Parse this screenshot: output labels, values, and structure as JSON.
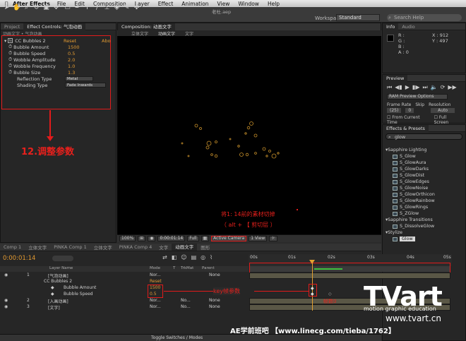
{
  "menubar": {
    "apple": "",
    "app_name": "After Effects",
    "items": [
      "File",
      "Edit",
      "Composition",
      "Layer",
      "Effect",
      "Animation",
      "View",
      "Window",
      "Help"
    ]
  },
  "document_title": "老杜.aep",
  "workspace": {
    "label": "Workspace:",
    "value": "Standard"
  },
  "search_help": "Search Help",
  "project_tabs": {
    "project": "Project",
    "effect_controls": "Effect Controls: 气泡动画"
  },
  "effect_controls": {
    "breadcrumb": "动画文字 • 气泡动画",
    "effect_name": "CC Bubbles 2",
    "reset": "Reset",
    "about": "Abo",
    "params": [
      {
        "name": "Bubble Amount",
        "value": "1500"
      },
      {
        "name": "Bubble Speed",
        "value": "0.5"
      },
      {
        "name": "Wobble Amplitude",
        "value": "2.0"
      },
      {
        "name": "Wobble Frequency",
        "value": "1.0"
      },
      {
        "name": "Bubble Size",
        "value": "1.3"
      }
    ],
    "reflection_type": {
      "name": "Reflection Type",
      "value": "Metal"
    },
    "shading_type": {
      "name": "Shading Type",
      "value": "Fade Inwards"
    }
  },
  "annotation_adjust": "12.调整参数",
  "composition": {
    "tab": "Composition: 动画文字",
    "subtabs": [
      "立体文字",
      "动画文字",
      "文字"
    ]
  },
  "viewer_controls": {
    "zoom": "100%",
    "timecode": "0:00:01:14",
    "resolution": "Full",
    "camera": "Active Camera",
    "views": "1 View"
  },
  "annotation_cut": "将1:  14前的素材切掉",
  "annotation_cut_sub": "（ alt + 【 剪切层 ）",
  "info": {
    "tabs": [
      "Info",
      "Audio"
    ],
    "r": "R :",
    "g": "G :",
    "b": "B :",
    "a": "A : 0",
    "x": "X : 912",
    "y": "Y : 497"
  },
  "preview": {
    "title": "Preview",
    "ram_options": "RAM Preview Options",
    "frame_rate_label": "Frame Rate",
    "skip_label": "Skip",
    "resolution_label": "Resolution",
    "frame_rate": "(25)",
    "skip": "0",
    "resolution": "Auto",
    "from_current": "From Current Time",
    "full_screen": "Full Screen"
  },
  "effects_presets": {
    "title": "Effects & Presets",
    "search": "glow",
    "groups": [
      {
        "name": "Sapphire Lighting",
        "items": [
          "S_Glow",
          "S_GlowAura",
          "S_GlowDarks",
          "S_GlowDist",
          "S_GlowEdges",
          "S_GlowNoise",
          "S_GlowOrthicon",
          "S_GlowRainbow",
          "S_GlowRings",
          "S_ZGlow"
        ]
      },
      {
        "name": "Sapphire Transitions",
        "items": [
          "S_DissolveGlow"
        ]
      },
      {
        "name": "Stylize",
        "items": [
          "Glow"
        ]
      }
    ]
  },
  "timeline": {
    "tabs": [
      "Comp 1",
      "立体文字",
      "PINKA Comp 1",
      "立体文字",
      "PINKA Comp 4",
      "文字",
      "动画文字",
      "图形"
    ],
    "timecode": "0:00:01:14",
    "columns": {
      "layer_name": "Layer Name",
      "mode": "Mode",
      "t": "T",
      "trkmat": "TrkMat",
      "parent": "Parent"
    },
    "ruler": [
      "00s",
      "01s",
      "02s",
      "03s",
      "04s",
      "05s"
    ],
    "layers": [
      {
        "num": "1",
        "name": "[气泡动画]",
        "mode": "Nor...",
        "parent": "None"
      },
      {
        "num": "2",
        "name": "[入画动画]",
        "mode": "Nor...",
        "trkmat": "No...",
        "parent": "None"
      },
      {
        "num": "3",
        "name": "[文字]",
        "mode": "Nor...",
        "trkmat": "No...",
        "parent": "None"
      }
    ],
    "effect_group": "CC Bubbles 2",
    "effect_reset": "Reset",
    "bubble_amount": {
      "name": "Bubble Amount",
      "value": "1500"
    },
    "bubble_speed": {
      "name": "Bubble Speed",
      "value": "0.5"
    },
    "footer": "Toggle Switches / Modes"
  },
  "annotation_key": "key帧参数",
  "annotation_frame": "帧数0",
  "watermark": {
    "logo": "TVart",
    "tagline": "motion graphic education",
    "url": "www.tvart.cn"
  },
  "footer_credit": "AE学前班吧  【www.linecg.com/tieba/1762】"
}
